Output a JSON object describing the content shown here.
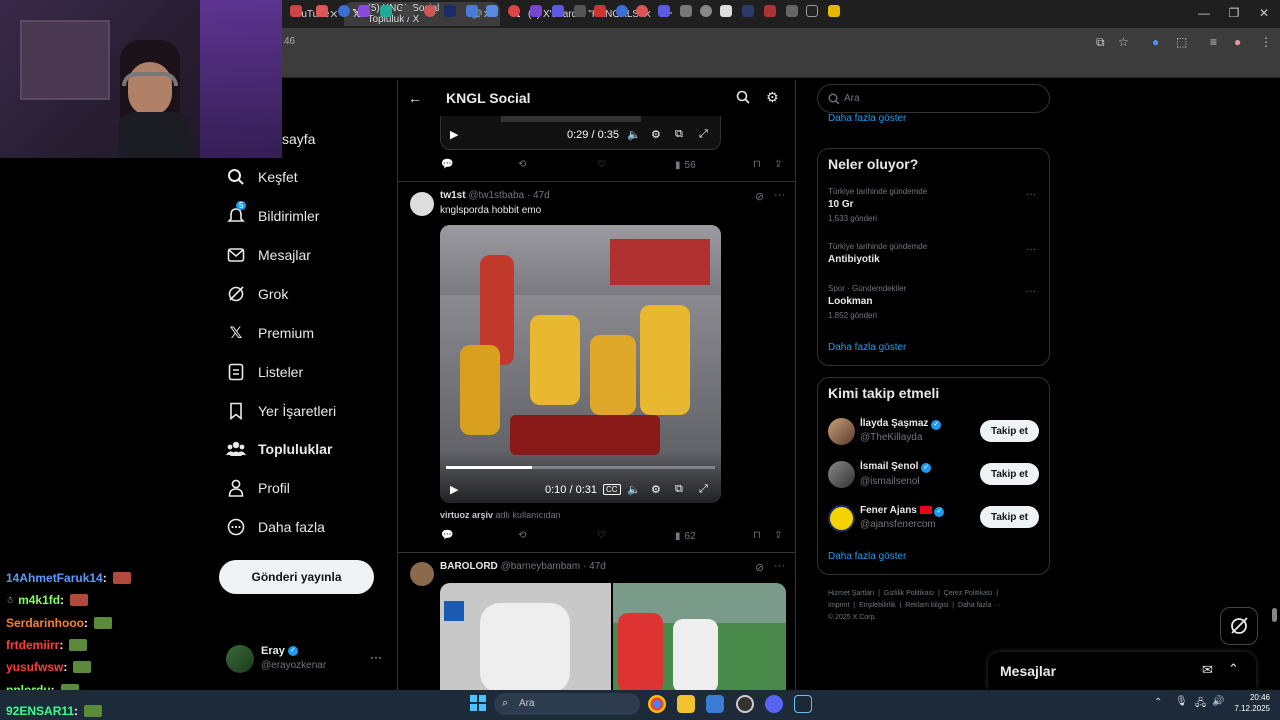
{
  "browser": {
    "tabs": [
      {
        "title": "YouTube"
      },
      {
        "title": "(5) KNGL Social Topluluk / X"
      },
      {
        "title": "(4) X'te arda: \"KANGALSPOR-m"
      }
    ],
    "url_fragment": "46"
  },
  "sidebar": {
    "items": [
      {
        "label": "sayfa",
        "icon": "home-icon"
      },
      {
        "label": "Keşfet",
        "icon": "search-icon"
      },
      {
        "label": "Bildirimler",
        "icon": "bell-icon",
        "badge": "5"
      },
      {
        "label": "Mesajlar",
        "icon": "mail-icon"
      },
      {
        "label": "Grok",
        "icon": "grok-icon"
      },
      {
        "label": "Premium",
        "icon": "x-logo-icon"
      },
      {
        "label": "Listeler",
        "icon": "list-icon"
      },
      {
        "label": "Yer İşaretleri",
        "icon": "bookmark-icon"
      },
      {
        "label": "Topluluklar",
        "icon": "communities-icon"
      },
      {
        "label": "Profil",
        "icon": "person-icon"
      },
      {
        "label": "Daha fazla",
        "icon": "more-circle-icon"
      }
    ],
    "post_button": "Gönderi yayınla",
    "account": {
      "name": "Eray",
      "handle": "@erayozkenar"
    }
  },
  "header": {
    "title": "KNGL Social"
  },
  "posts": [
    {
      "video_time": "0:29 / 0:35",
      "views": "56"
    },
    {
      "author": "tw1st",
      "handle": "@tw1stbaba",
      "time": "· 47d",
      "text": "knglsporda hobbit emo",
      "video_time": "0:10 / 0:31",
      "cc": "CC",
      "progress": 0.32,
      "attribution_user": "virtuoz arşiv",
      "attribution_suffix": "adlı kullanıcıdan",
      "views": "62"
    },
    {
      "author": "BAROLORD",
      "handle": "@barneybambam",
      "time": "· 47d"
    }
  ],
  "search": {
    "placeholder": "Ara"
  },
  "right": {
    "show_more_top": "Daha fazla göster",
    "trends_title": "Neler oluyor?",
    "trends": [
      {
        "context": "Türkiye tarihinde gündemde",
        "name": "10 Gr",
        "count": "1.533 gönderi"
      },
      {
        "context": "Türkiye tarihinde gündemde",
        "name": "Antibiyotik",
        "count": ""
      },
      {
        "context": "Spor · Gündemdekiler",
        "name": "Lookman",
        "count": "1.852 gönderi"
      }
    ],
    "trends_more": "Daha fazla göster",
    "who_title": "Kimi takip etmeli",
    "who": [
      {
        "name": "İlayda Şaşmaz",
        "handle": "@TheKillayda",
        "button": "Takip et"
      },
      {
        "name": "İsmail Şenol",
        "handle": "@ismailsenol",
        "button": "Takip et"
      },
      {
        "name": "Fener Ajans",
        "handle": "@ajansfenercom",
        "button": "Takip et"
      }
    ],
    "who_more": "Daha fazla göster",
    "footer": [
      "Hizmet Şartları",
      "Gizlilik Politikası",
      "Çerez Politikası",
      "Imprint",
      "Erişilebilirlik",
      "Reklam bilgisi",
      "Daha fazla ···",
      "© 2025 X Corp."
    ]
  },
  "messages_bar": {
    "title": "Mesajlar"
  },
  "chat": [
    {
      "user": "14AhmetFaruk14",
      "color": "#5b9bff",
      "sep": " :"
    },
    {
      "user": "m4k1fd",
      "color": "#7fff5b",
      "sep": " :"
    },
    {
      "user": "Serdarinhooo",
      "color": "#ff7f2a",
      "sep": " :"
    },
    {
      "user": "frtdemiirr",
      "color": "#ff3b3b",
      "sep": " :"
    },
    {
      "user": "yusufwsw",
      "color": "#ff3b3b",
      "sep": " :"
    },
    {
      "user": "pplordu",
      "color": "#7fff5b",
      "sep": " :"
    },
    {
      "user": "92ENSAR11",
      "color": "#3bff8a",
      "sep": " :"
    }
  ],
  "taskbar": {
    "search_placeholder": "Ara",
    "time": "20:46",
    "date": "7.12.2025"
  }
}
